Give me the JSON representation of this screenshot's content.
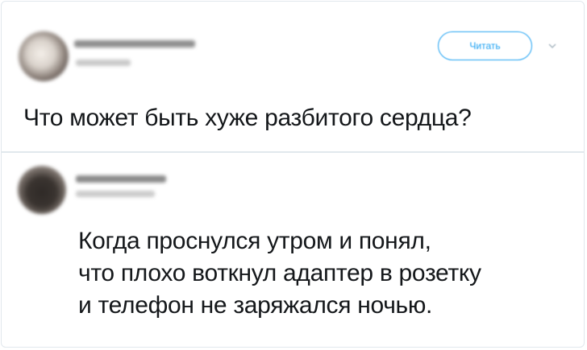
{
  "tweet1": {
    "follow_label": "Читать",
    "chevron_icon": "chevron-down-icon",
    "text": "Что может быть хуже разбитого сердца?"
  },
  "tweet2": {
    "lines": [
      "Когда проснулся утром и понял,",
      "что плохо воткнул адаптер в розетку",
      "и телефон не заряжался ночью."
    ]
  },
  "colors": {
    "accent": "#1da1f2",
    "text": "#14171a",
    "border": "#e1e8ed"
  }
}
